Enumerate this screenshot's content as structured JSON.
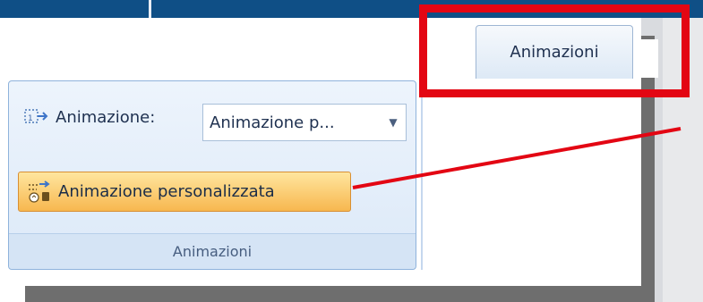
{
  "tab": {
    "label": "Animazioni"
  },
  "ribbon": {
    "group_label": "Animazioni",
    "animation_label": "Animazione:",
    "animation_selected": "Animazione p...",
    "custom_animation_label": "Animazione personalizzata"
  },
  "icons": {
    "animation": "animation-icon",
    "custom_animation": "custom-animation-icon",
    "dropdown": "chevron-down-icon"
  },
  "colors": {
    "highlight": "#e30613",
    "title_bar": "#0f4f86",
    "ribbon": "#dce9f8",
    "button_active": "#f7b74f"
  }
}
